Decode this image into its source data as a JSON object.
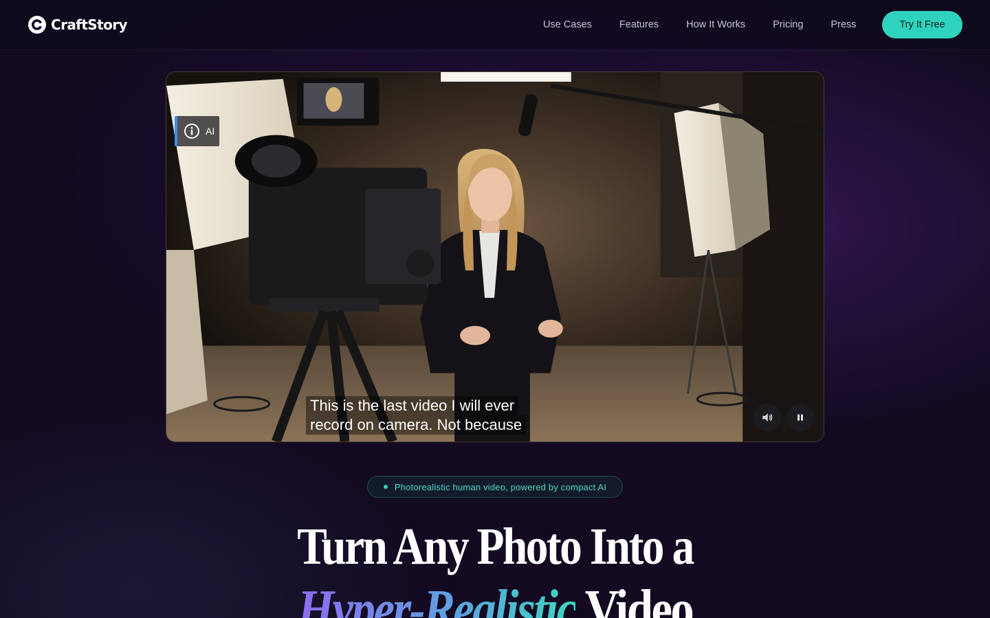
{
  "brand": {
    "name": "CraftStory"
  },
  "nav": {
    "items": [
      {
        "label": "Use Cases"
      },
      {
        "label": "Features"
      },
      {
        "label": "How It Works"
      },
      {
        "label": "Pricing"
      },
      {
        "label": "Press"
      }
    ],
    "cta_label": "Try It Free"
  },
  "video": {
    "badge_label": "AI",
    "caption_line1": "This is the last video I will ever",
    "caption_line2": "record on camera. Not because",
    "controls": {
      "volume_icon": "speaker-icon",
      "pause_icon": "pause-icon"
    }
  },
  "hero": {
    "pill_text": "Photorealistic human video, powered by compact AI",
    "headline_line1": "Turn Any Photo Into a",
    "headline_accent": "Hyper-Realistic",
    "headline_end": "Video"
  },
  "colors": {
    "background": "#130a22",
    "accent_teal": "#2fd3bd",
    "badge_blue": "#3c8cf0",
    "gradient_start": "#8e6cf0",
    "gradient_end": "#3dd6c0"
  }
}
